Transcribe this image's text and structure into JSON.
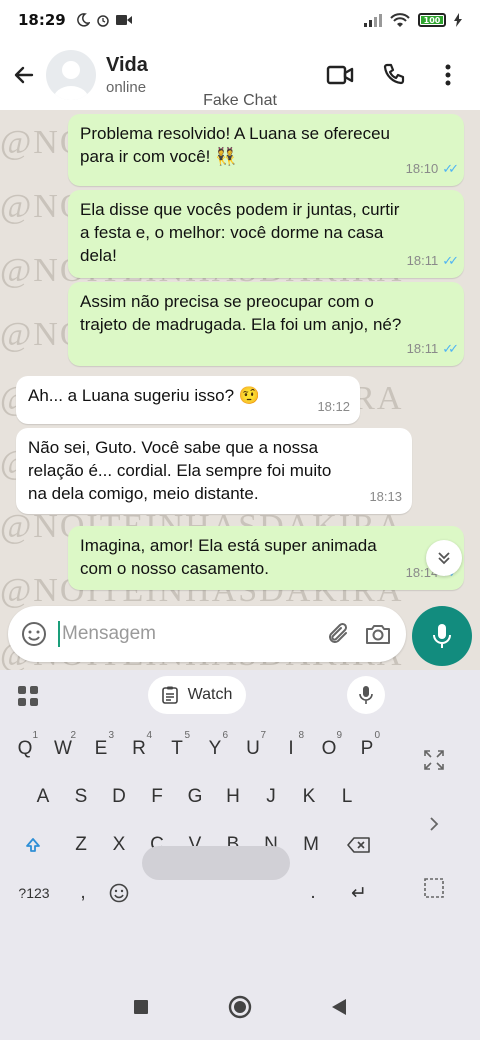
{
  "status_bar": {
    "time": "18:29",
    "battery": "100"
  },
  "header": {
    "contact_name": "Vida",
    "contact_status": "online",
    "overlay_label": "Fake Chat"
  },
  "watermark_text": "@NOITEINHASDAKIRA",
  "messages": [
    {
      "direction": "out",
      "lines": [
        "Problema resolvido! A Luana se ofereceu",
        "para ir com você! 👯"
      ],
      "time": "18:10",
      "read": true
    },
    {
      "direction": "out",
      "lines": [
        " Ela disse que vocês podem ir juntas, curtir",
        "a festa e, o melhor: você dorme na casa",
        "dela!"
      ],
      "time": "18:11",
      "read": true
    },
    {
      "direction": "out",
      "lines": [
        "Assim não precisa se preocupar com o",
        "trajeto de madrugada. Ela foi um anjo, né?"
      ],
      "time": "18:11",
      "read": true
    },
    {
      "direction": "in",
      "lines": [
        "Ah... a Luana sugeriu isso? 🤨"
      ],
      "time": "18:12"
    },
    {
      "direction": "in",
      "lines": [
        "Não sei, Guto. Você sabe que a nossa",
        "relação é... cordial. Ela sempre foi muito",
        "na dela comigo, meio distante."
      ],
      "time": "18:13"
    },
    {
      "direction": "out",
      "lines": [
        "Imagina, amor! Ela está super animada",
        "com o nosso casamento."
      ],
      "time": "18:14",
      "read": true
    }
  ],
  "composer": {
    "placeholder": "Mensagem"
  },
  "keyboard": {
    "suggestion_chip": "Watch",
    "row1": [
      "Q",
      "W",
      "E",
      "R",
      "T",
      "Y",
      "U",
      "I",
      "O",
      "P"
    ],
    "row1_digits": [
      "1",
      "2",
      "3",
      "4",
      "5",
      "6",
      "7",
      "8",
      "9",
      "0"
    ],
    "row2": [
      "A",
      "S",
      "D",
      "F",
      "G",
      "H",
      "J",
      "K",
      "L"
    ],
    "row3": [
      "Z",
      "X",
      "C",
      "V",
      "B",
      "N",
      "M"
    ],
    "symbols_key": "?123",
    "comma_key": ",",
    "period_key": ".",
    "enter_key": "↵"
  },
  "colors": {
    "accent": "#128c7e",
    "outgoing_bubble": "#dcf8c6",
    "incoming_bubble": "#ffffff",
    "read_ticks": "#4fb4f3",
    "chat_background": "#e7e2dc"
  },
  "icons": [
    "back-arrow-icon",
    "video-call-icon",
    "phone-icon",
    "more-vert-icon",
    "emoji-icon",
    "attach-icon",
    "camera-icon",
    "mic-icon",
    "chevron-double-down-icon"
  ]
}
